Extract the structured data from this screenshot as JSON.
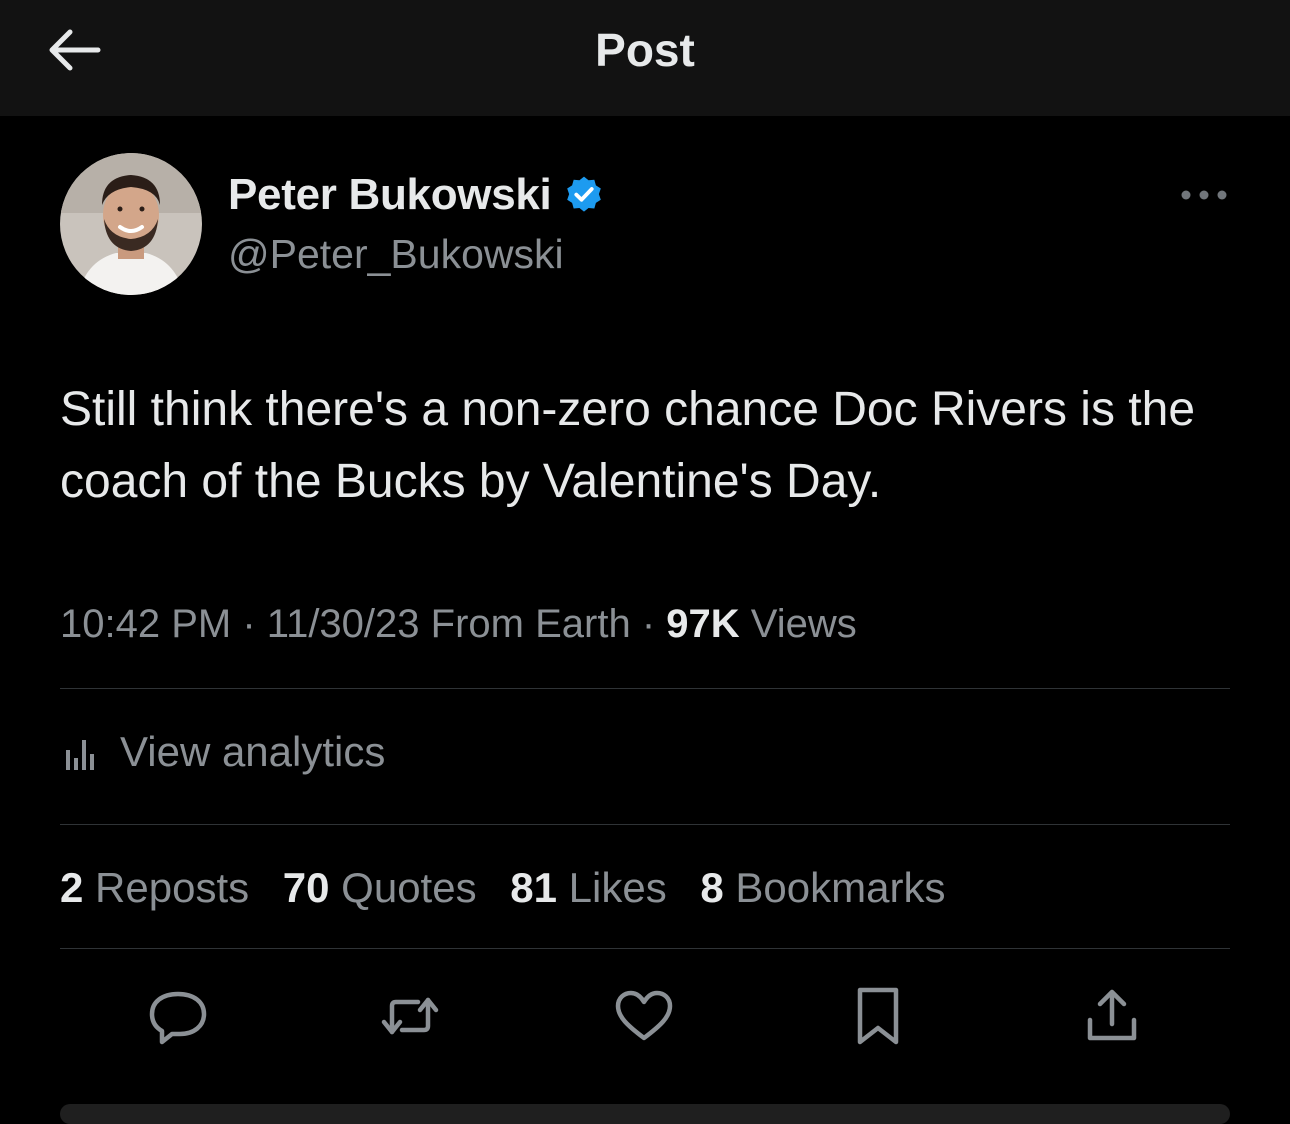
{
  "header": {
    "title": "Post",
    "back_icon": "arrow-left-icon"
  },
  "author": {
    "display_name": "Peter Bukowski",
    "handle": "@Peter_Bukowski",
    "verified": true,
    "verified_color": "#1d9bf0"
  },
  "tweet": {
    "text": "Still think there's a non-zero chance Doc Rivers is the coach of the Bucks by Valentine's Day."
  },
  "meta": {
    "time": "10:42 PM",
    "separator": "·",
    "date": "11/30/23",
    "source": "From Earth",
    "views_count": "97K",
    "views_label": "Views"
  },
  "analytics": {
    "label": "View analytics",
    "icon": "bar-chart-icon"
  },
  "stats": [
    {
      "count": "2",
      "label": "Reposts"
    },
    {
      "count": "70",
      "label": "Quotes"
    },
    {
      "count": "81",
      "label": "Likes"
    },
    {
      "count": "8",
      "label": "Bookmarks"
    }
  ],
  "actions": [
    {
      "name": "reply",
      "icon": "speech-bubble-icon"
    },
    {
      "name": "repost",
      "icon": "repost-icon"
    },
    {
      "name": "like",
      "icon": "heart-icon"
    },
    {
      "name": "bookmark",
      "icon": "bookmark-icon"
    },
    {
      "name": "share",
      "icon": "share-icon"
    }
  ],
  "colors": {
    "background": "#000000",
    "header_bg": "#121212",
    "text_primary": "#e7e9ea",
    "text_secondary": "#8b9095",
    "divider": "#2f3336"
  }
}
